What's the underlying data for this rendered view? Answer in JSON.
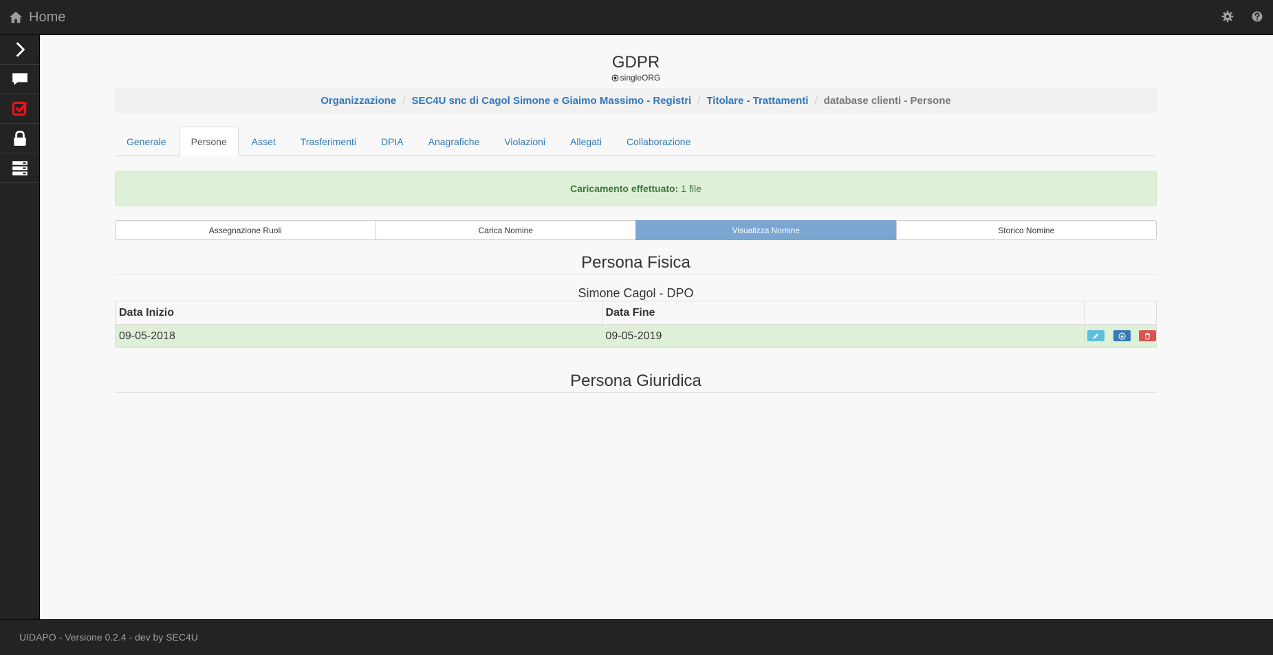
{
  "topbar": {
    "home_label": "Home",
    "icons": [
      "home-icon",
      "gear-icon",
      "help-icon"
    ]
  },
  "sidebar": {
    "items": [
      {
        "icon": "chevron-right-icon"
      },
      {
        "icon": "chat-icon"
      },
      {
        "icon": "checkbox-icon",
        "color": "#e8131a"
      },
      {
        "icon": "lock-icon"
      },
      {
        "icon": "server-icon"
      }
    ]
  },
  "header": {
    "title": "GDPR",
    "subtitle": "singleORG"
  },
  "breadcrumb": {
    "items": [
      "Organizzazione",
      "SEC4U snc di Cagol Simone e Giaimo Massimo - Registri",
      "Titolare - Trattamenti"
    ],
    "separator": "/",
    "active": "database clienti - Persone"
  },
  "tabs": {
    "items": [
      "Generale",
      "Persone",
      "Asset",
      "Trasferimenti",
      "DPIA",
      "Anagrafiche",
      "Violazioni",
      "Allegati",
      "Collaborazione"
    ],
    "active_index": 1
  },
  "alert": {
    "bold": "Caricamento effettuato:",
    "text": "1 file"
  },
  "buttons": {
    "items": [
      "Assegnazione Ruoli",
      "Carica Nomine",
      "Visualizza Nomine",
      "Storico Nomine"
    ],
    "active_index": 2
  },
  "persona_fisica": {
    "title": "Persona Fisica",
    "person": "Simone Cagol - DPO",
    "columns": [
      "Data Inizio",
      "Data Fine"
    ],
    "rows": [
      {
        "start": "09-05-2018",
        "end": "09-05-2019"
      }
    ]
  },
  "persona_giuridica": {
    "title": "Persona Giuridica"
  },
  "footer": {
    "text": "UIDAPO - Versione 0.2.4 - dev by SEC4U"
  },
  "colors": {
    "link": "#2f77b8",
    "edit_button": "#5bc0de",
    "download_button": "#337ab7",
    "delete_button": "#d9534f",
    "success_bg": "#dff0d8",
    "active_button": "#7ca6d2"
  }
}
